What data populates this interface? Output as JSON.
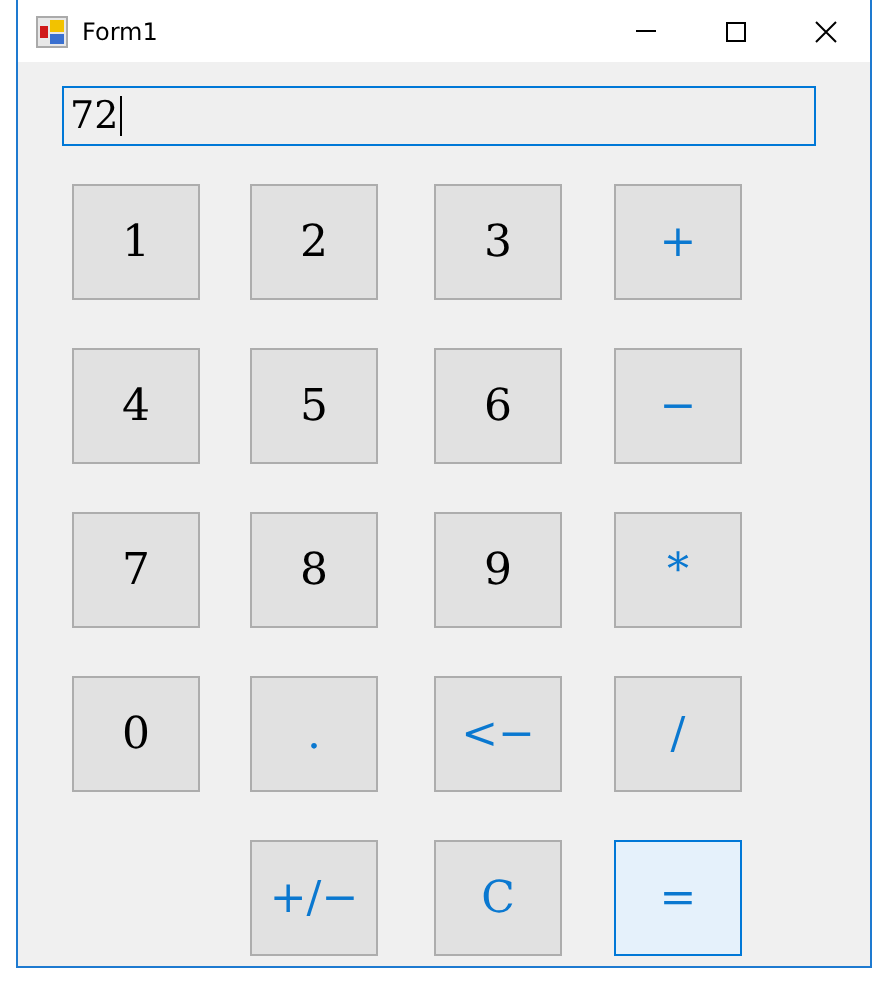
{
  "window": {
    "title": "Form1"
  },
  "display": {
    "value": "72",
    "focused": true
  },
  "keypad": [
    {
      "buttons": [
        {
          "label": "1",
          "kind": "digit",
          "focused": false
        },
        {
          "label": "2",
          "kind": "digit",
          "focused": false
        },
        {
          "label": "3",
          "kind": "digit",
          "focused": false
        },
        {
          "label": "+",
          "kind": "operator",
          "focused": false
        }
      ]
    },
    {
      "buttons": [
        {
          "label": "4",
          "kind": "digit",
          "focused": false
        },
        {
          "label": "5",
          "kind": "digit",
          "focused": false
        },
        {
          "label": "6",
          "kind": "digit",
          "focused": false
        },
        {
          "label": "−",
          "kind": "operator",
          "focused": false
        }
      ]
    },
    {
      "buttons": [
        {
          "label": "7",
          "kind": "digit",
          "focused": false
        },
        {
          "label": "8",
          "kind": "digit",
          "focused": false
        },
        {
          "label": "9",
          "kind": "digit",
          "focused": false
        },
        {
          "label": "*",
          "kind": "operator",
          "focused": false
        }
      ]
    },
    {
      "buttons": [
        {
          "label": "0",
          "kind": "digit",
          "focused": false
        },
        {
          "label": ".",
          "kind": "operator",
          "focused": false
        },
        {
          "label": "<−",
          "kind": "operator",
          "focused": false
        },
        {
          "label": "/",
          "kind": "operator",
          "focused": false
        }
      ]
    },
    {
      "buttons": [
        {
          "label": "+/−",
          "kind": "operator",
          "focused": false
        },
        {
          "label": "C",
          "kind": "operator",
          "focused": false
        },
        {
          "label": "=",
          "kind": "operator",
          "focused": true
        }
      ]
    }
  ]
}
